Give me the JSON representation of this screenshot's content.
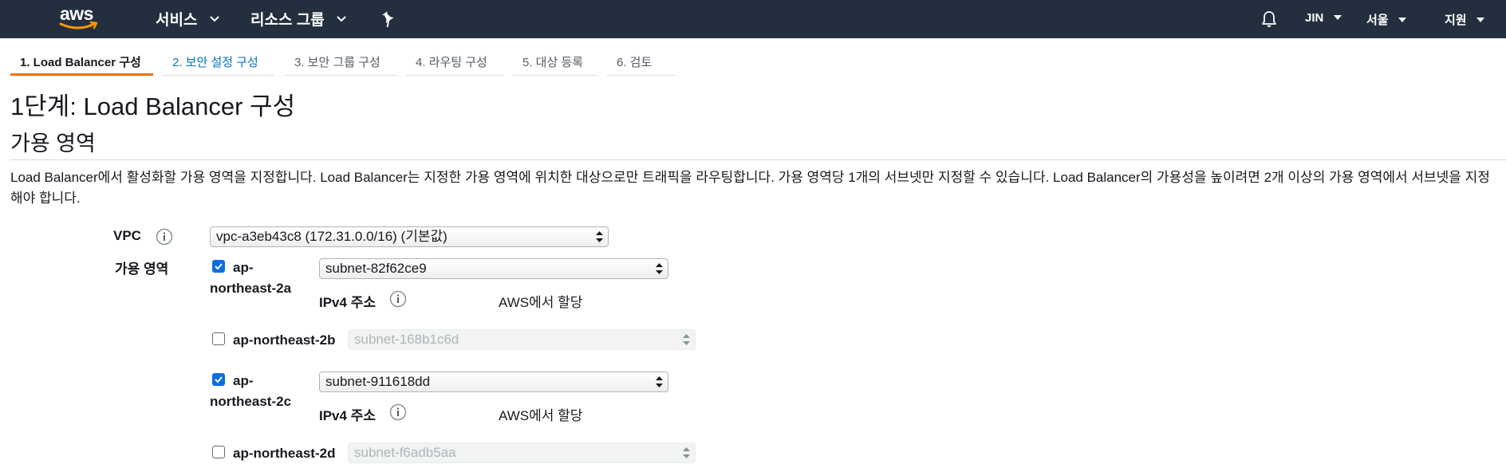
{
  "topnav": {
    "logo_text": "aws",
    "services_label": "서비스",
    "resource_groups_label": "리소스 그룹",
    "account_label": "JIN",
    "region_label": "서울",
    "support_label": "지원"
  },
  "tabs": [
    {
      "label": "1. Load Balancer 구성",
      "state": "active"
    },
    {
      "label": "2. 보안 설정 구성",
      "state": "done"
    },
    {
      "label": "3. 보안 그룹 구성",
      "state": "pending"
    },
    {
      "label": "4. 라우팅 구성",
      "state": "pending"
    },
    {
      "label": "5. 대상 등록",
      "state": "pending"
    },
    {
      "label": "6. 검토",
      "state": "pending"
    }
  ],
  "page": {
    "title": "1단계: Load Balancer 구성",
    "section_title": "가용 영역",
    "description": "Load Balancer에서 활성화할 가용 영역을 지정합니다. Load Balancer는 지정한 가용 영역에 위치한 대상으로만 트래픽을 라우팅합니다. 가용 영역당 1개의 서브넷만 지정할 수 있습니다. Load Balancer의 가용성을 높이려면 2개 이상의 가용 영역에서 서브넷을 지정해야 합니다."
  },
  "form": {
    "vpc_label": "VPC",
    "vpc_value": "vpc-a3eb43c8 (172.31.0.0/16) (기본값)",
    "az_label": "가용 영역",
    "ipv4_label": "IPv4 주소",
    "ipv4_value": "AWS에서 할당",
    "zones": [
      {
        "name": "ap-northeast-2a",
        "line1": "ap-",
        "line2": "northeast-2a",
        "checked": true,
        "subnet": "subnet-82f62ce9"
      },
      {
        "name": "ap-northeast-2b",
        "checked": false,
        "subnet": "subnet-168b1c6d"
      },
      {
        "name": "ap-northeast-2c",
        "line1": "ap-",
        "line2": "northeast-2c",
        "checked": true,
        "subnet": "subnet-911618dd"
      },
      {
        "name": "ap-northeast-2d",
        "checked": false,
        "subnet": "subnet-f6adb5aa"
      }
    ]
  },
  "colors": {
    "nav_bg": "#232f3e",
    "accent_orange": "#ec7211",
    "link_blue": "#0073bb",
    "checkbox_blue": "#0b6ee0"
  },
  "icons": {
    "logo": "aws-logo-icon",
    "pin": "pin-icon",
    "bell": "bell-icon",
    "info": "info-icon",
    "caret": "caret-down-icon",
    "select_arrows": "select-arrows-icon"
  }
}
